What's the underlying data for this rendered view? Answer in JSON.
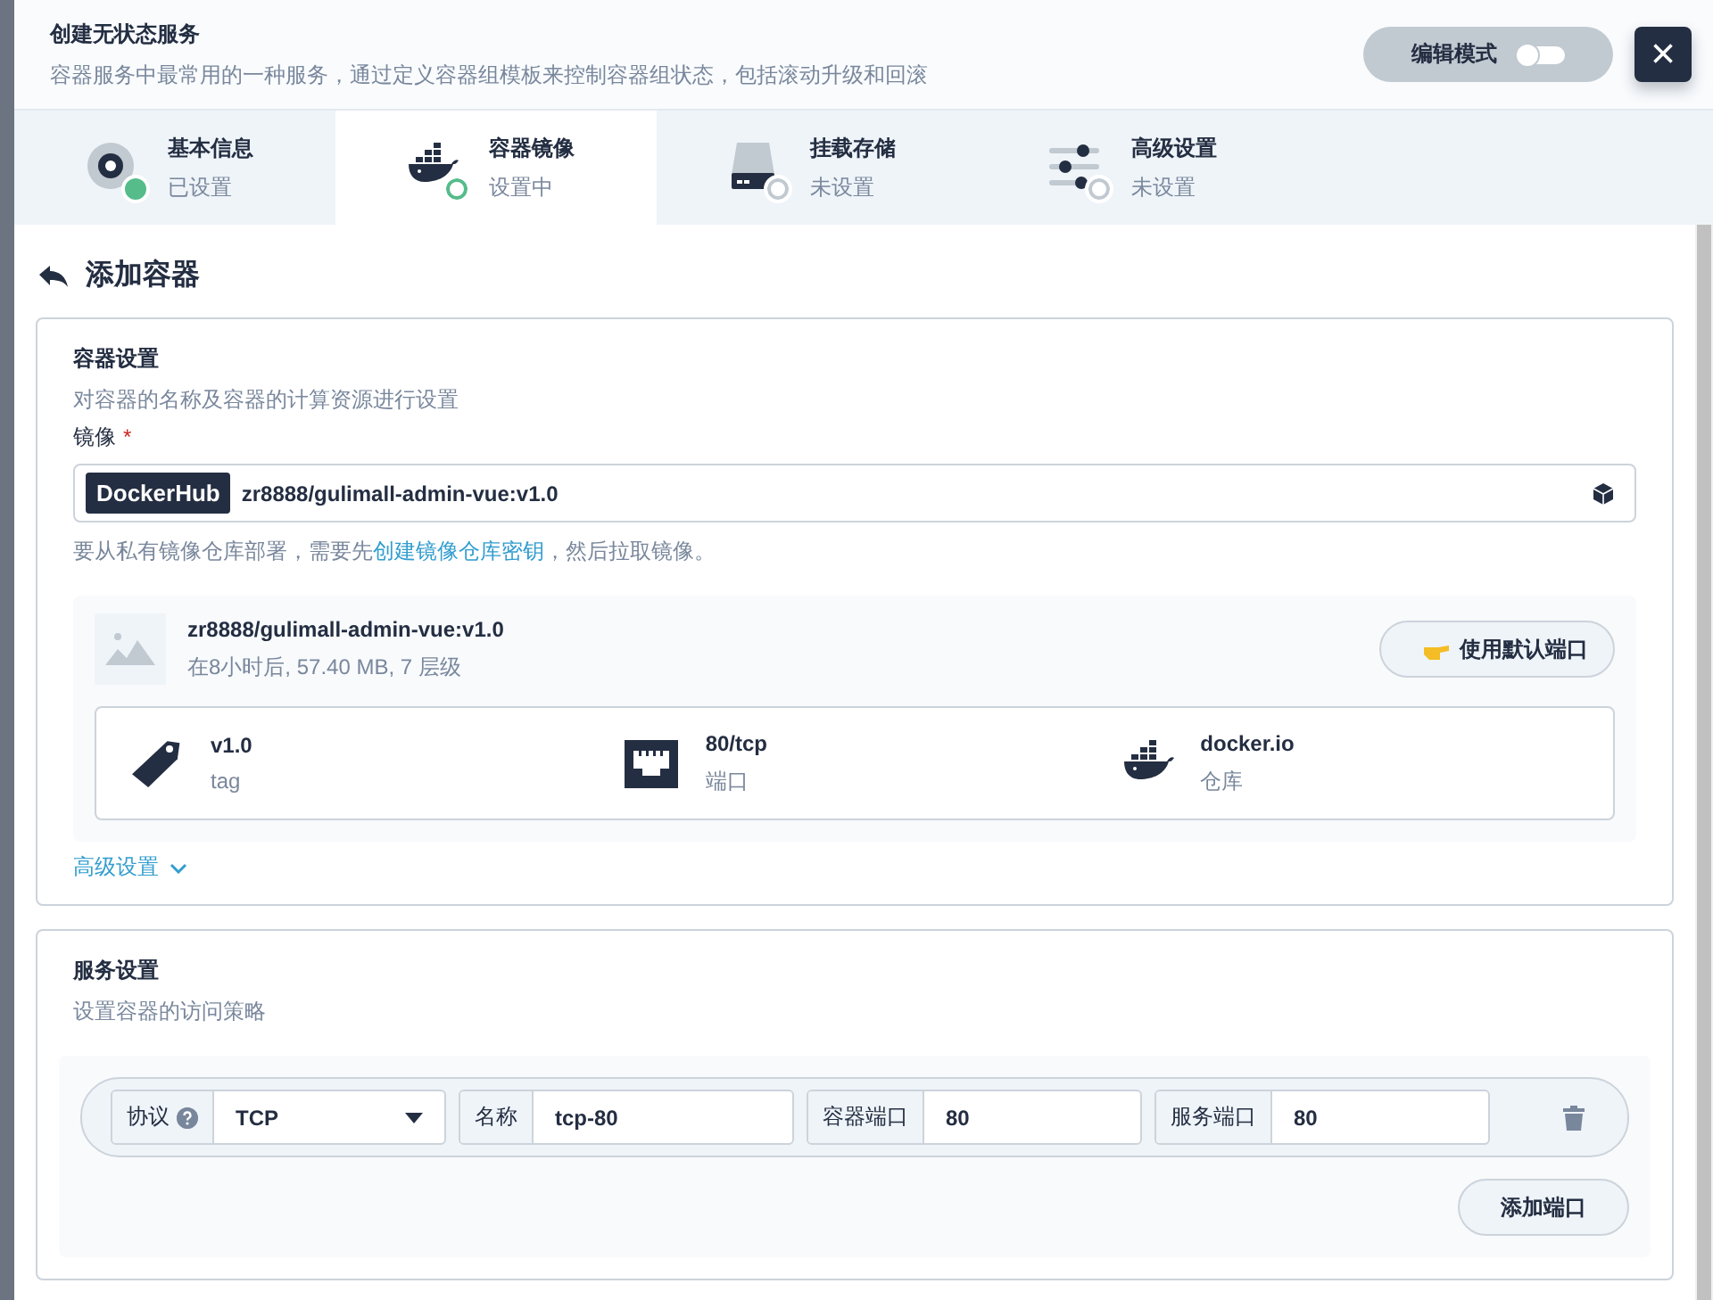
{
  "header": {
    "title": "创建无状态服务",
    "subtitle": "容器服务中最常用的一种服务，通过定义容器组模板来控制容器组状态，包括滚动升级和回滚",
    "edit_mode": {
      "label": "编辑模式",
      "on": false
    },
    "close": "×"
  },
  "steps": [
    {
      "kind": "disk",
      "title": "基本信息",
      "status": "已设置",
      "done": true,
      "current": false,
      "selected": false
    },
    {
      "kind": "docker",
      "title": "容器镜像",
      "status": "设置中",
      "done": false,
      "current": true,
      "selected": true
    },
    {
      "kind": "drive",
      "title": "挂载存储",
      "status": "未设置",
      "done": false,
      "current": false,
      "selected": false
    },
    {
      "kind": "sliders",
      "title": "高级设置",
      "status": "未设置",
      "done": false,
      "current": false,
      "selected": false
    }
  ],
  "section_title": "添加容器",
  "container_settings": {
    "title": "容器设置",
    "description": "对容器的名称及容器的计算资源进行设置",
    "image_label": "镜像",
    "required_mark": "*",
    "registry": "DockerHub",
    "image_value": "zr8888/gulimall-admin-vue:v1.0",
    "hint_before": "要从私有镜像仓库部署，需要先",
    "hint_link": "创建镜像仓库密钥",
    "hint_after": "，然后拉取镜像。",
    "image_info": {
      "name": "zr8888/gulimall-admin-vue:v1.0",
      "meta": "在8小时后, 57.40 MB, 7 层级",
      "button": "使用默认端口",
      "details": [
        {
          "kind": "tag",
          "value": "v1.0",
          "label": "tag"
        },
        {
          "kind": "port",
          "value": "80/tcp",
          "label": "端口"
        },
        {
          "kind": "registry",
          "value": "docker.io",
          "label": "仓库"
        }
      ]
    },
    "advanced": {
      "label": "高级设置",
      "expanded": false
    }
  },
  "service_settings": {
    "title": "服务设置",
    "description": "设置容器的访问策略",
    "ports": [
      {
        "protocol_label": "协议",
        "protocol": "TCP",
        "name_label": "名称",
        "name": "tcp-80",
        "container_port_label": "容器端口",
        "container_port": "80",
        "service_port_label": "服务端口",
        "service_port": "80"
      }
    ],
    "add_button": "添加端口"
  }
}
